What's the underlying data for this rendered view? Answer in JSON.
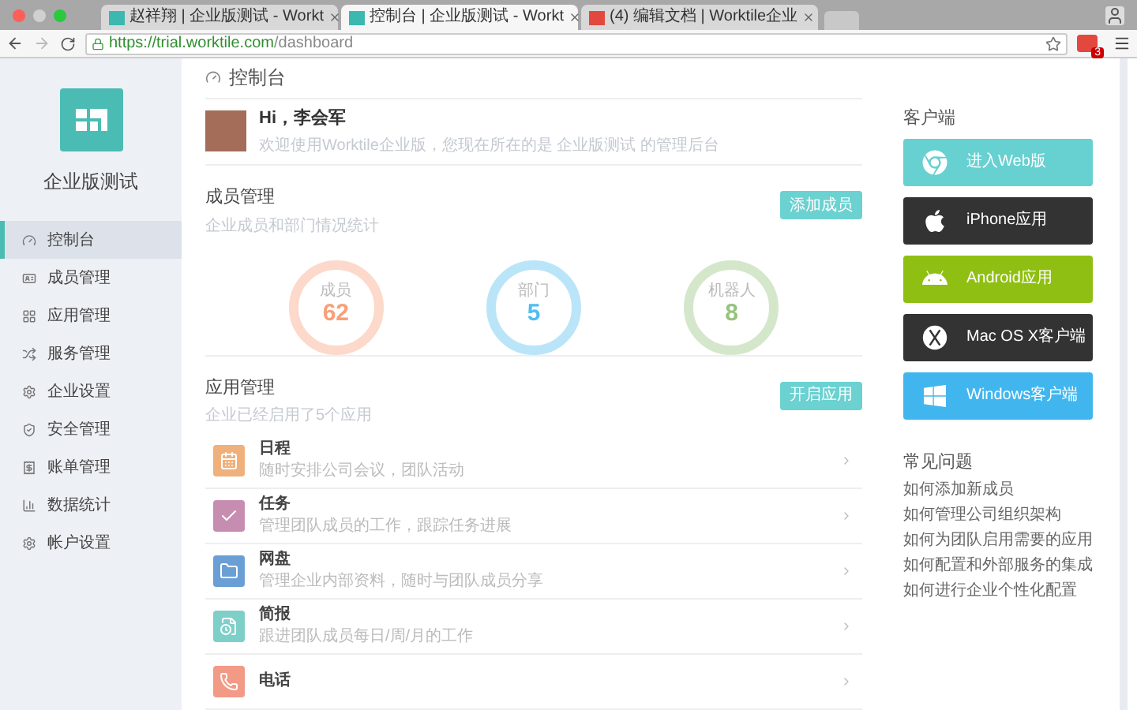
{
  "browser": {
    "tabs": [
      {
        "title": "赵祥翔 | 企业版测试 - Workt",
        "selected": false,
        "color": "#3bb8b0"
      },
      {
        "title": "控制台 | 企业版测试 - Workt",
        "selected": true,
        "color": "#3bb8b0"
      },
      {
        "title": "(4) 编辑文档 | Worktile企业",
        "selected": false,
        "color": "#e2483d"
      }
    ],
    "url_host": "https://trial.worktile.com",
    "url_path": "/dashboard",
    "extension_badge": "3"
  },
  "sidebar": {
    "org_name": "企业版测试",
    "items": [
      {
        "label": "控制台",
        "selected": true,
        "kind": "dashboard"
      },
      {
        "label": "成员管理",
        "selected": false,
        "kind": "members"
      },
      {
        "label": "应用管理",
        "selected": false,
        "kind": "apps"
      },
      {
        "label": "服务管理",
        "selected": false,
        "kind": "services"
      },
      {
        "label": "企业设置",
        "selected": false,
        "kind": "settings"
      },
      {
        "label": "安全管理",
        "selected": false,
        "kind": "security"
      },
      {
        "label": "账单管理",
        "selected": false,
        "kind": "billing"
      },
      {
        "label": "数据统计",
        "selected": false,
        "kind": "stats"
      },
      {
        "label": "帐户设置",
        "selected": false,
        "kind": "settings"
      }
    ]
  },
  "header": {
    "title": "控制台"
  },
  "welcome": {
    "greeting": "Hi，李会军",
    "message": "欢迎使用Worktile企业版，您现在所在的是 企业版测试 的管理后台"
  },
  "members": {
    "title": "成员管理",
    "subtitle": "企业成员和部门情况统计",
    "button": "添加成员",
    "stats": [
      {
        "label": "成员",
        "value": "62",
        "color": "#f7a07a"
      },
      {
        "label": "部门",
        "value": "5",
        "color": "#52bdf0"
      },
      {
        "label": "机器人",
        "value": "8",
        "color": "#96c37d"
      }
    ]
  },
  "apps": {
    "title": "应用管理",
    "subtitle": "企业已经启用了5个应用",
    "button": "开启应用",
    "items": [
      {
        "name": "日程",
        "description": "随时安排公司会议，团队活动",
        "color": "#f0b07c",
        "kind": "calendar"
      },
      {
        "name": "任务",
        "description": "管理团队成员的工作，跟踪任务进展",
        "color": "#c78db0",
        "kind": "task"
      },
      {
        "name": "网盘",
        "description": "管理企业内部资料，随时与团队成员分享",
        "color": "#6a9fd6",
        "kind": "folder"
      },
      {
        "name": "简报",
        "description": "跟进团队成员每日/周/月的工作",
        "color": "#7fcfc9",
        "kind": "report"
      },
      {
        "name": "电话",
        "color": "#f29a86",
        "kind": "phone"
      }
    ]
  },
  "clients": {
    "title": "客户端",
    "buttons": [
      {
        "label": "进入Web版",
        "kind": "web",
        "color": "#67d0d0"
      },
      {
        "label": "iPhone应用",
        "kind": "apple",
        "color": "#333333"
      },
      {
        "label": "Android应用",
        "kind": "android",
        "color": "#8fbf13"
      },
      {
        "label": "Mac OS X客户端",
        "kind": "mac",
        "color": "#333333"
      },
      {
        "label": "Windows客户端",
        "kind": "windows",
        "color": "#41b6ee"
      }
    ]
  },
  "faq": {
    "title": "常见问题",
    "links": [
      "如何添加新成员",
      "如何管理公司组织架构",
      "如何为团队启用需要的应用",
      "如何配置和外部服务的集成",
      "如何进行企业个性化配置"
    ]
  }
}
